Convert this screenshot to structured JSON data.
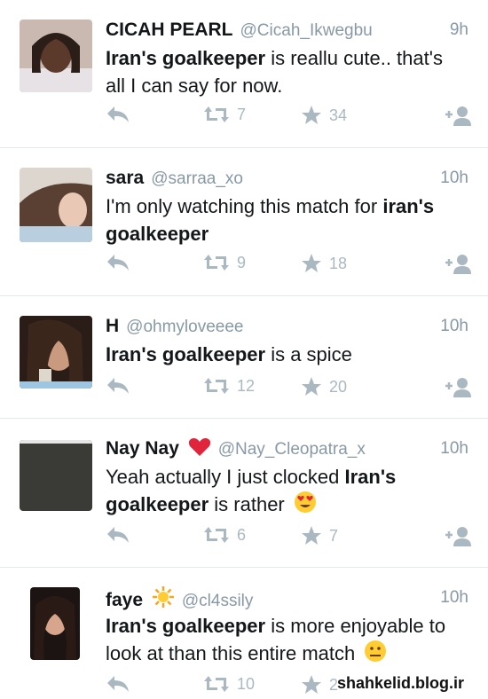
{
  "tweets": [
    {
      "name": "CICAH PEARL",
      "handle": "@Cicah_Ikwegbu",
      "time": "9h",
      "text_bold": "Iran's goalkeeper",
      "text_rest": " is reallu cute.. that's all I can say for now.",
      "retweets": "7",
      "favorites": "34",
      "avatar_icon": "user-photo"
    },
    {
      "name": "sara",
      "handle": "@sarraa_xo",
      "time": "10h",
      "text_pre": "I'm only watching this match for ",
      "text_bold": "iran's goalkeeper",
      "retweets": "9",
      "favorites": "18",
      "avatar_icon": "user-photo"
    },
    {
      "name": "H",
      "handle": "@ohmyloveeee",
      "time": "10h",
      "text_bold": "Iran's goalkeeper",
      "text_rest": " is a spice",
      "retweets": "12",
      "favorites": "20",
      "avatar_icon": "user-photo"
    },
    {
      "name": "Nay Nay",
      "name_emoji": "heart-emoji",
      "handle": "@Nay_Cleopatra_x",
      "time": "10h",
      "text_pre": "Yeah actually I just clocked ",
      "text_bold": "Iran's goalkeeper",
      "text_rest": " is rather",
      "text_emoji": "heart-eyes-emoji",
      "retweets": "6",
      "favorites": "7",
      "avatar_icon": "user-photo"
    },
    {
      "name": "faye",
      "name_emoji": "sun-emoji",
      "handle": "@cl4ssily",
      "time": "10h",
      "text_bold": "Iran's goalkeeper",
      "text_rest": " is more enjoyable to look at than this entire match",
      "text_emoji": "neutral-face-emoji",
      "retweets": "10",
      "favorites": "2",
      "avatar_icon": "user-photo"
    }
  ],
  "icons": {
    "reply": "reply-icon",
    "retweet": "retweet-icon",
    "favorite": "star-icon",
    "follow": "follow-icon"
  },
  "colors": {
    "icon_gray": "#aab8c2",
    "handle_gray": "#8899a6",
    "divider": "#e1e8ed"
  },
  "watermark": "shahkelid.blog.ir"
}
